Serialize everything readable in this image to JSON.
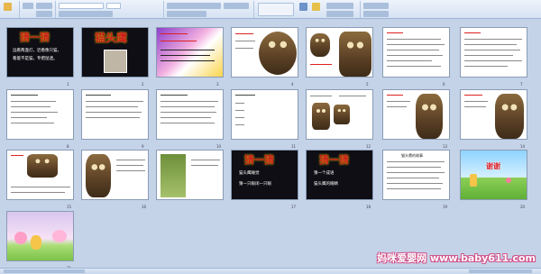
{
  "slides": {
    "s1": {
      "title": "猜一猜",
      "lines": [
        "远看两盏灯，近看像只猫，",
        "看着不是猫，专把鼠逮。"
      ],
      "num": "1"
    },
    "s2": {
      "title": "猫头鹰",
      "num": "2"
    },
    "s3": {
      "num": "3"
    },
    "s4": {
      "num": "4"
    },
    "s5": {
      "num": "5"
    },
    "s6": {
      "num": "6"
    },
    "s7": {
      "num": "7"
    },
    "s8": {
      "num": "8"
    },
    "s9": {
      "num": "9"
    },
    "s10": {
      "num": "10"
    },
    "s11": {
      "num": "11"
    },
    "s12": {
      "num": "12"
    },
    "s13": {
      "num": "13"
    },
    "s14": {
      "num": "14"
    },
    "s15": {
      "num": "15"
    },
    "s16": {
      "num": "16"
    },
    "s17": {
      "title": "猜一猜",
      "lines": [
        "猫头鹰睡觉",
        "猜一只眼闭一只眼"
      ],
      "num": "17"
    },
    "s18": {
      "title": "猜一猜",
      "lines": [
        "猜一个成语",
        "猫头鹰的眼睛"
      ],
      "num": "18"
    },
    "s19": {
      "title": "猫头鹰的故事",
      "num": "19"
    },
    "s20": {
      "title": "谢谢",
      "num": "20"
    },
    "s21": {
      "num": "21"
    }
  },
  "watermark": "妈咪爱婴网 www.baby611.com",
  "colors": {
    "ribbon": "#d6e2f3",
    "sorter_bg": "#c4d3e8",
    "title_red": "#c81e1e"
  }
}
